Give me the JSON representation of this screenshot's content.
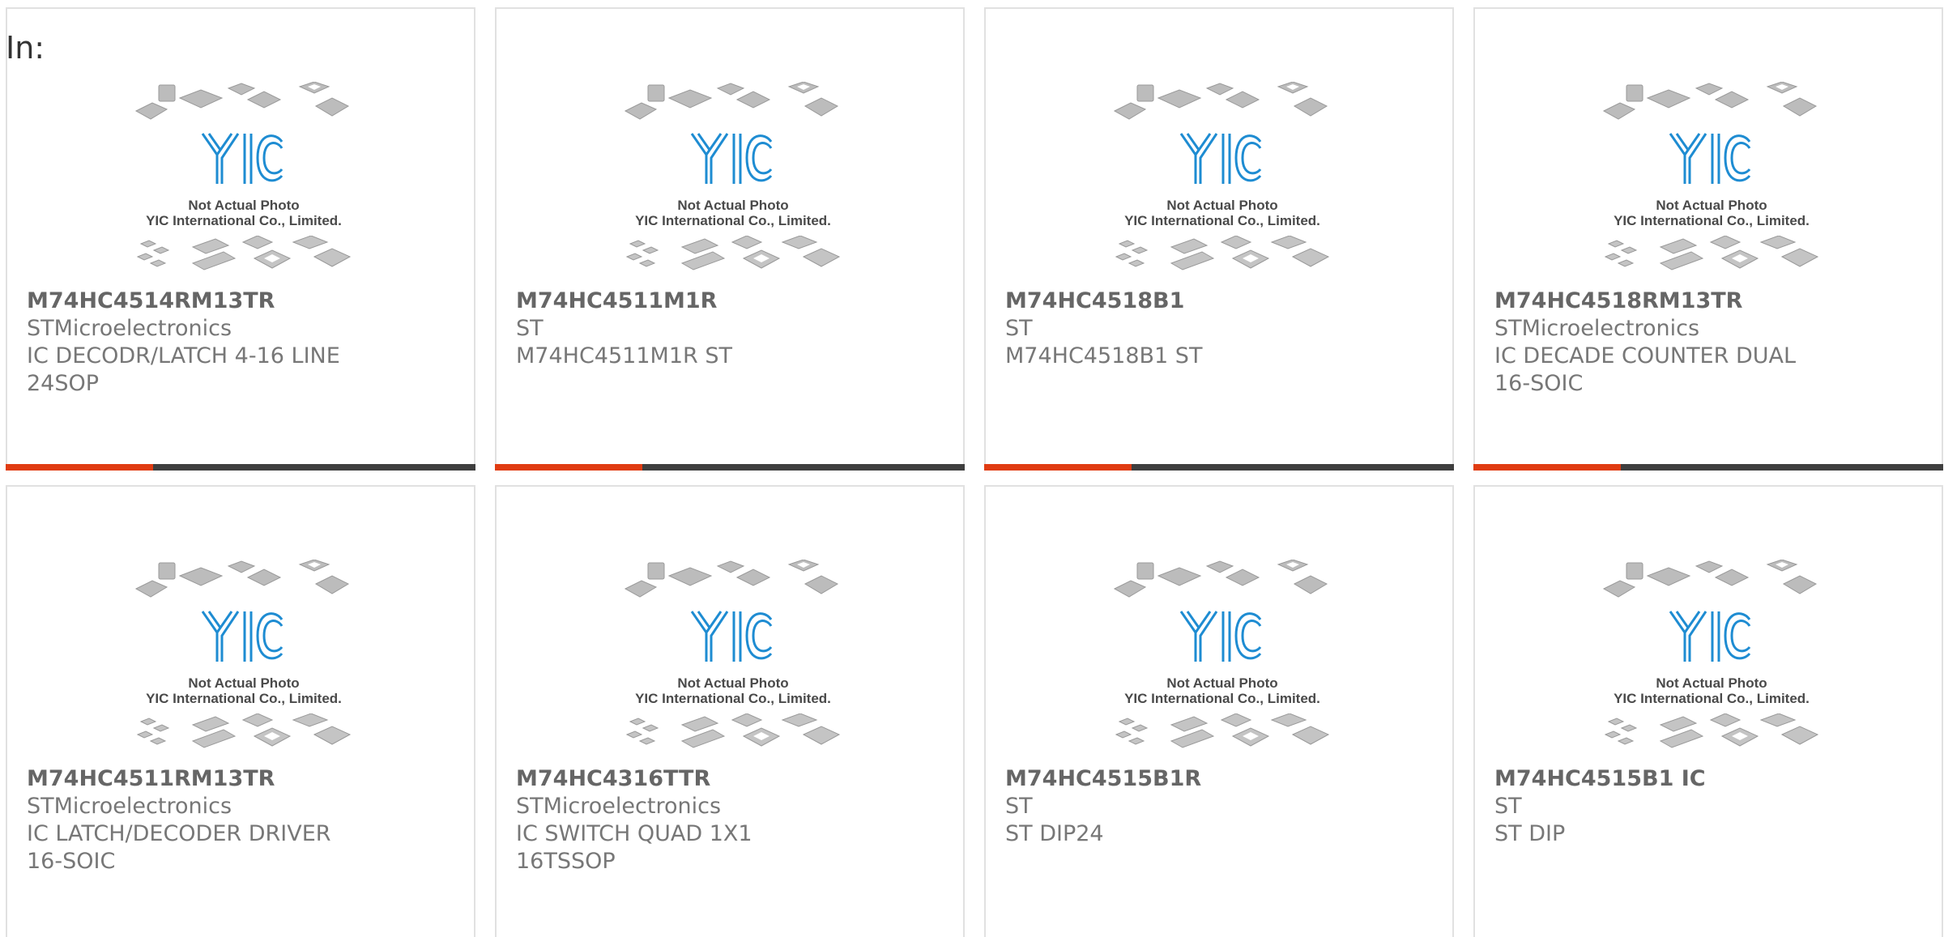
{
  "page": {
    "label": "In:"
  },
  "placeholder": {
    "caption_line1": "Not Actual Photo",
    "caption_line2": "YIC International Co., Limited.",
    "logo_text": "YIC"
  },
  "colors": {
    "accent": "#e03c12",
    "bar": "#3f3f3f",
    "logo_blue": "#1e8cd2",
    "border": "#e1e1e1"
  },
  "products": [
    {
      "part_number": "M74HC4514RM13TR",
      "manufacturer": "STMicroelectronics",
      "description": "IC DECODR/LATCH 4-16 LINE 24SOP"
    },
    {
      "part_number": "M74HC4511M1R",
      "manufacturer": "ST",
      "description": "M74HC4511M1R ST"
    },
    {
      "part_number": "M74HC4518B1",
      "manufacturer": "ST",
      "description": "M74HC4518B1 ST"
    },
    {
      "part_number": "M74HC4518RM13TR",
      "manufacturer": "STMicroelectronics",
      "description": "IC DECADE COUNTER DUAL 16-SOIC"
    },
    {
      "part_number": "M74HC4511RM13TR",
      "manufacturer": "STMicroelectronics",
      "description": "IC LATCH/DECODER DRIVER 16-SOIC"
    },
    {
      "part_number": "M74HC4316TTR",
      "manufacturer": "STMicroelectronics",
      "description": "IC SWITCH QUAD 1X1 16TSSOP"
    },
    {
      "part_number": "M74HC4515B1R",
      "manufacturer": "ST",
      "description": "ST DIP24"
    },
    {
      "part_number": "M74HC4515B1 IC",
      "manufacturer": "ST",
      "description": "ST DIP"
    }
  ]
}
